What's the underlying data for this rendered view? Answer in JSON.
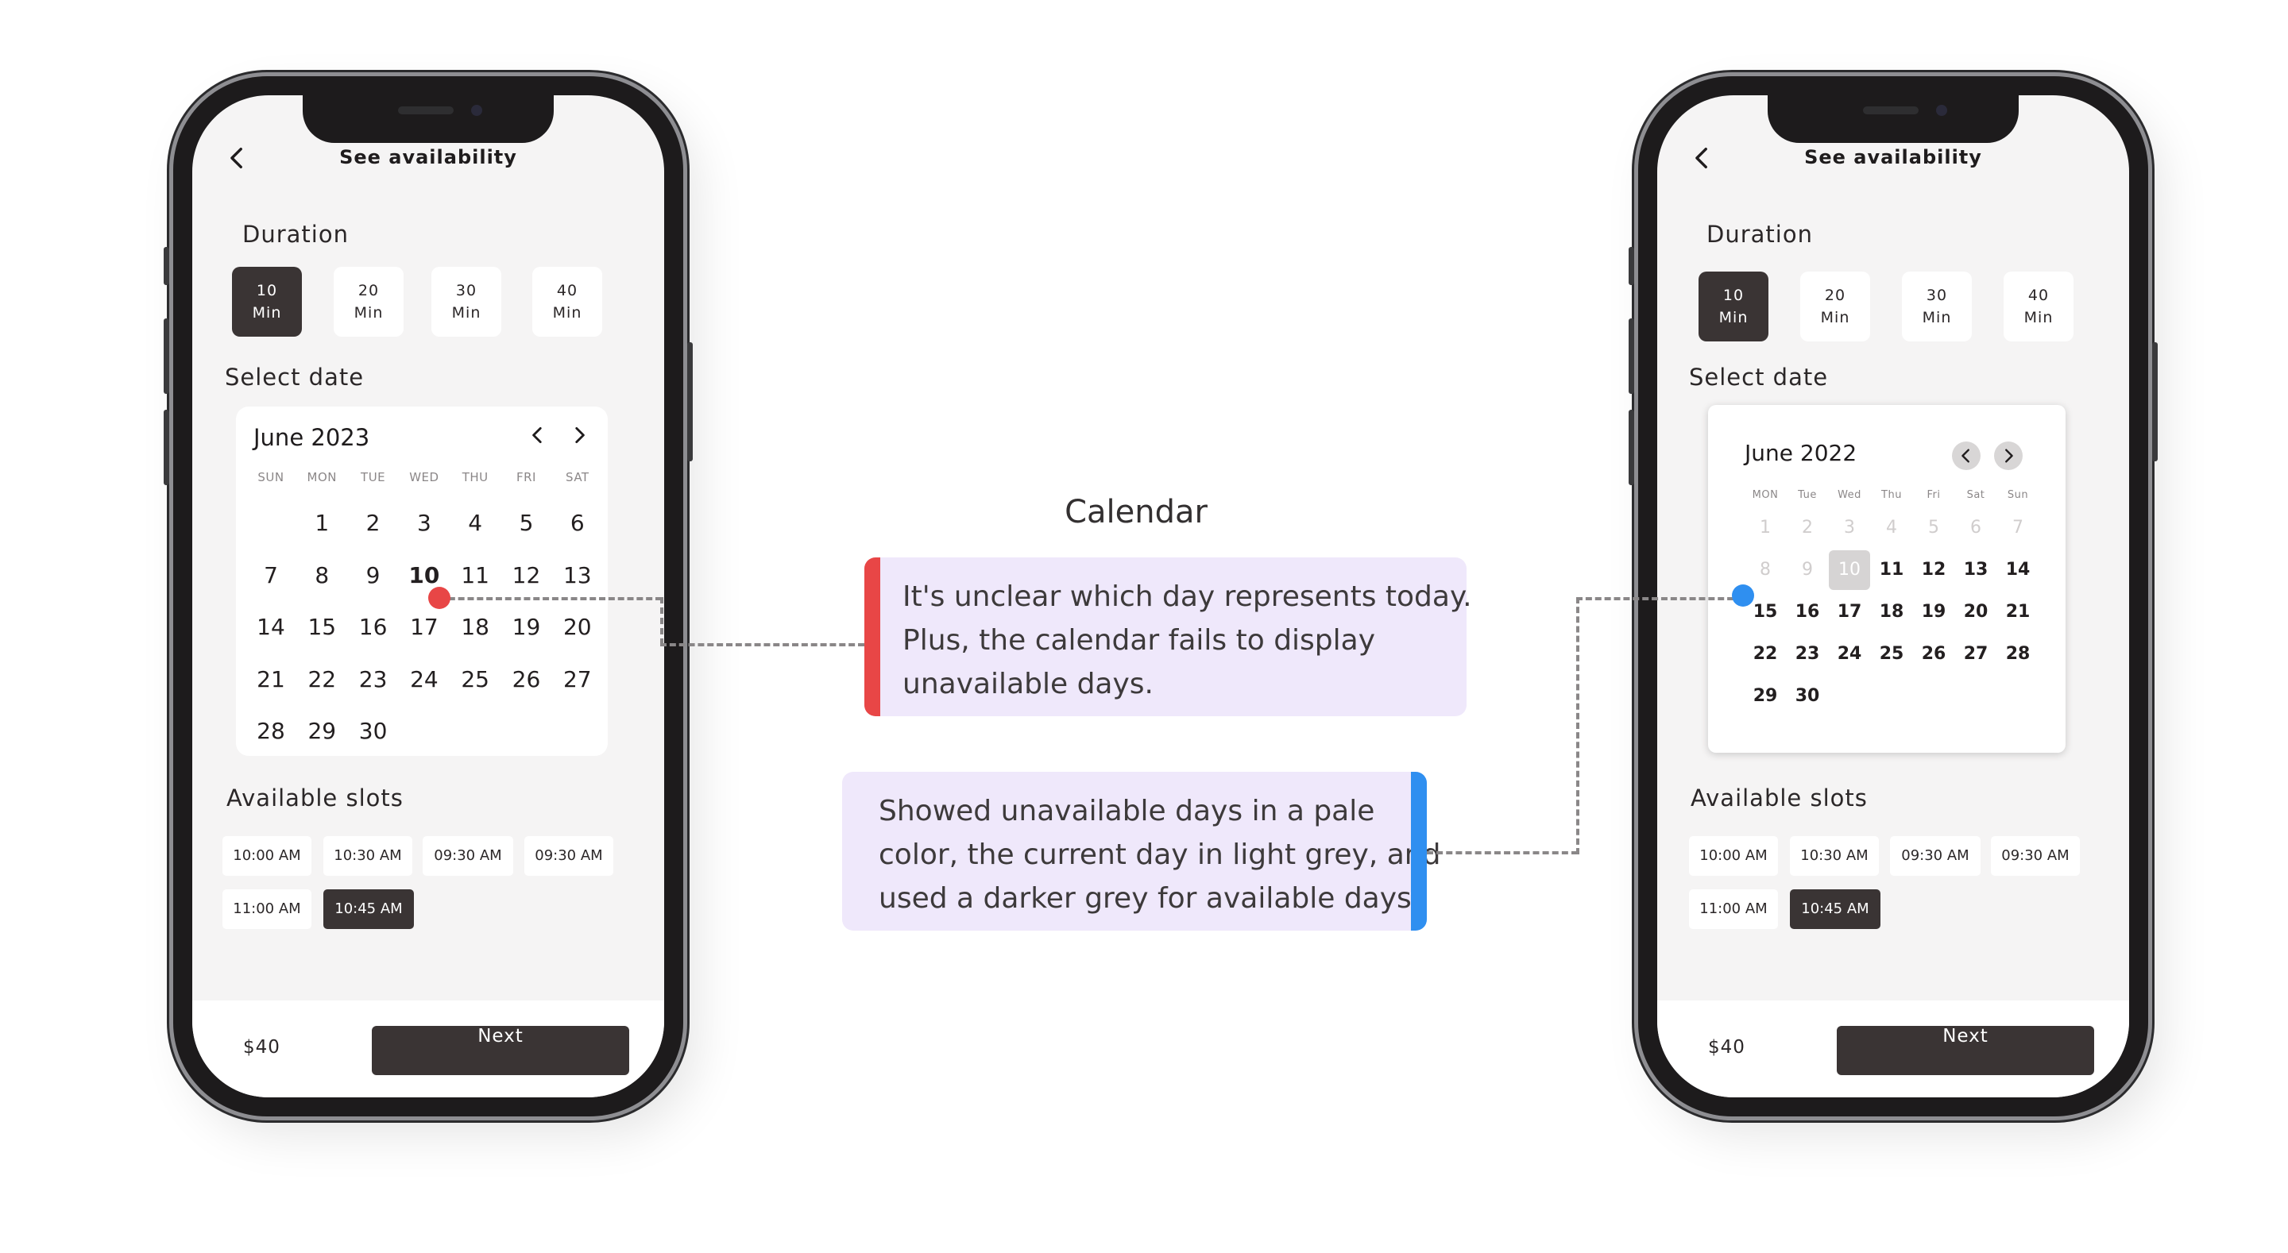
{
  "left_phone": {
    "title": "See availability",
    "duration_label": "Duration",
    "durations": [
      {
        "num": "10",
        "unit": "Min"
      },
      {
        "num": "20",
        "unit": "Min"
      },
      {
        "num": "30",
        "unit": "Min"
      },
      {
        "num": "40",
        "unit": "Min"
      }
    ],
    "selected_duration": "10",
    "select_date_label": "Select date",
    "calendar": {
      "month": "June 2023",
      "weekdays": [
        "SUN",
        "MON",
        "TUE",
        "WED",
        "THU",
        "FRI",
        "SAT"
      ],
      "days": [
        "1",
        "2",
        "3",
        "4",
        "5",
        "6",
        "7",
        "8",
        "9",
        "10",
        "11",
        "12",
        "13",
        "14",
        "15",
        "16",
        "17",
        "18",
        "19",
        "20",
        "21",
        "22",
        "23",
        "24",
        "25",
        "26",
        "27",
        "28",
        "29",
        "30"
      ],
      "bold_day": "10"
    },
    "slots_label": "Available slots",
    "slots": [
      "10:00 AM",
      "10:30 AM",
      "09:30 AM",
      "09:30 AM",
      "11:00 AM",
      "10:45 AM"
    ],
    "selected_slot": "10:45 AM",
    "price": "$40",
    "next_label": "Next"
  },
  "right_phone": {
    "title": "See availability",
    "duration_label": "Duration",
    "durations": [
      {
        "num": "10",
        "unit": "Min"
      },
      {
        "num": "20",
        "unit": "Min"
      },
      {
        "num": "30",
        "unit": "Min"
      },
      {
        "num": "40",
        "unit": "Min"
      }
    ],
    "selected_duration": "10",
    "select_date_label": "Select date",
    "calendar": {
      "month": "June 2022",
      "weekdays": [
        "MON",
        "Tue",
        "Wed",
        "Thu",
        "Fri",
        "Sat",
        "Sun"
      ],
      "days": [
        "1",
        "2",
        "3",
        "4",
        "5",
        "6",
        "7",
        "8",
        "9",
        "10",
        "11",
        "12",
        "13",
        "14",
        "15",
        "16",
        "17",
        "18",
        "19",
        "20",
        "21",
        "22",
        "23",
        "24",
        "25",
        "26",
        "27",
        "28",
        "29",
        "30"
      ],
      "unavailable_days": [
        "1",
        "2",
        "3",
        "4",
        "5",
        "6",
        "7",
        "8",
        "9"
      ],
      "today": "10"
    },
    "slots_label": "Available slots",
    "slots": [
      "10:00 AM",
      "10:30 AM",
      "09:30 AM",
      "09:30 AM",
      "11:00 AM",
      "10:45 AM"
    ],
    "selected_slot": "10:45 AM",
    "price": "$40",
    "next_label": "Next"
  },
  "annotations": {
    "title": "Calendar",
    "problem_lines": [
      "It's unclear which day represents today.",
      "Plus, the calendar fails to display",
      "unavailable days."
    ],
    "solution_lines": [
      "Showed unavailable days in a pale",
      "color, the current day in light grey, and",
      "used a darker grey for available days."
    ],
    "problem_color": "#e84646",
    "solution_color": "#2f8ff0"
  },
  "icons": {
    "back": "chevron-left-icon",
    "prev": "chevron-left-icon",
    "next": "chevron-right-icon"
  }
}
